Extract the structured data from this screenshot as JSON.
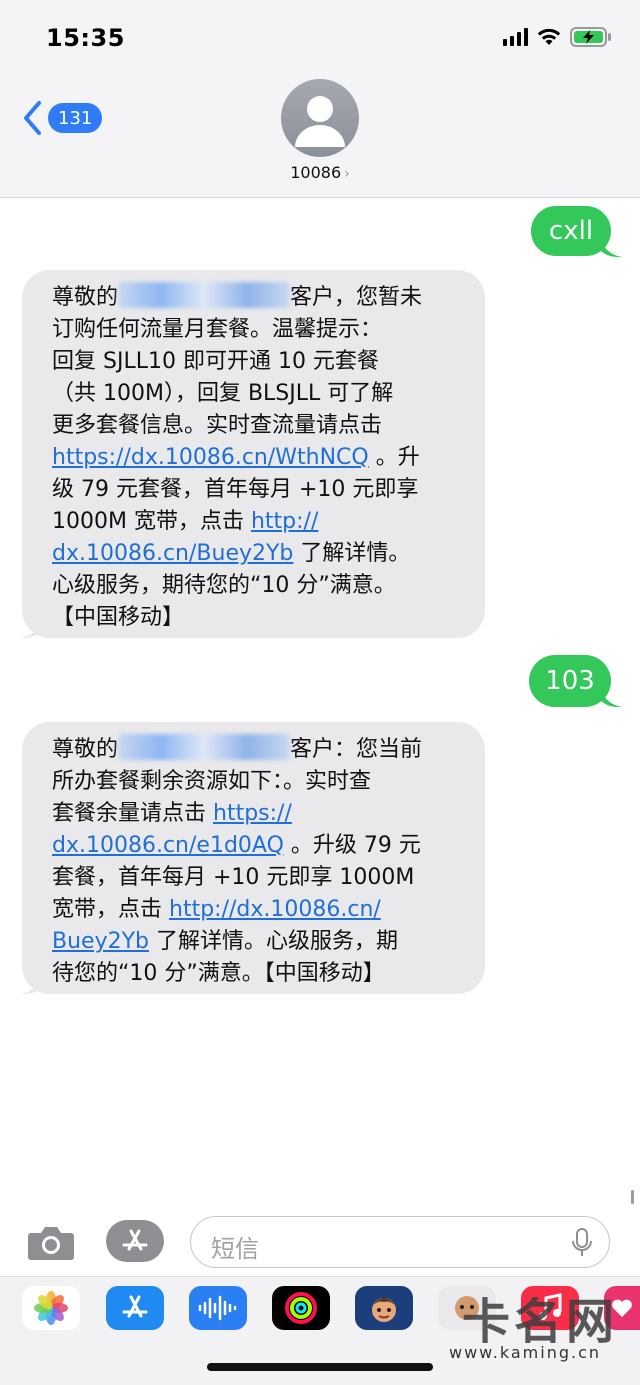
{
  "status_bar": {
    "time": "15:35"
  },
  "header": {
    "back_count": "131",
    "contact": "10086",
    "chevron": "›"
  },
  "messages": [
    {
      "type": "sent",
      "text": "cxll"
    },
    {
      "type": "received",
      "lines": [
        [
          "尊敬的",
          "[blurred]",
          "客户，您暂未"
        ],
        [
          "订购任何流量月套餐。温馨提示："
        ],
        [
          "回复 SJLL10 即可开通 10 元套餐"
        ],
        [
          "（共 100M），回复 BLSJLL 可了解"
        ],
        [
          "更多套餐信息。实时查流量请点击"
        ],
        [
          "https://dx.10086.cn/WthNCQ",
          " 。升"
        ],
        [
          "级 79 元套餐，首年每月 +10 元即享"
        ],
        [
          "1000M 宽带，点击 ",
          "http://"
        ],
        [
          "dx.10086.cn/Buey2Yb",
          " 了解详情。"
        ],
        [
          "心级服务，期待您的“10 分”满意。"
        ],
        [
          "【中国移动】"
        ]
      ]
    },
    {
      "type": "sent",
      "text": "103"
    },
    {
      "type": "received",
      "lines": [
        [
          "尊敬的",
          "[blurred]",
          "客户：您当前"
        ],
        [
          "所办套餐剩余资源如下：。实时查"
        ],
        [
          "套餐余量请点击 ",
          "https://"
        ],
        [
          "dx.10086.cn/e1d0AQ",
          " 。升级 79 元"
        ],
        [
          "套餐，首年每月 +10 元即享 1000M"
        ],
        [
          "宽带，点击 ",
          "http://dx.10086.cn/"
        ],
        [
          "Buey2Yb",
          " 了解详情。心级服务，期"
        ],
        [
          "待您的“10 分”满意。【中国移动】"
        ]
      ]
    }
  ],
  "m1": {
    "l1a": "尊敬的",
    "l1b": "客户，您暂未",
    "l2": "订购任何流量月套餐。温馨提示：",
    "l3": "回复 SJLL10 即可开通 10 元套餐",
    "l4": "（共 100M），回复 BLSJLL 可了解",
    "l5": "更多套餐信息。实时查流量请点击",
    "l6link": "https://dx.10086.cn/WthNCQ",
    "l6b": " 。升",
    "l7": "级 79 元套餐，首年每月 +10 元即享",
    "l8a": "1000M 宽带，点击 ",
    "l8link": "http://",
    "l9link": "dx.10086.cn/Buey2Yb",
    "l9b": " 了解详情。",
    "l10": "心级服务，期待您的“10 分”满意。",
    "l11": "【中国移动】"
  },
  "m2": {
    "l1a": "尊敬的",
    "l1b": "客户：您当前",
    "l2": "所办套餐剩余资源如下：。实时查",
    "l3a": "套餐余量请点击 ",
    "l3link": "https://",
    "l4link": "dx.10086.cn/e1d0AQ",
    "l4b": " 。升级 79 元",
    "l5": "套餐，首年每月 +10 元即享 1000M",
    "l6a": "宽带，点击 ",
    "l6link": "http://dx.10086.cn/",
    "l7link": "Buey2Yb",
    "l7b": " 了解详情。心级服务，期",
    "l8": "待您的“10 分”满意。【中国移动】"
  },
  "sent": {
    "s1": "cxll",
    "s2": "103"
  },
  "input": {
    "placeholder": "短信"
  },
  "drawer_apps": [
    "photos-icon",
    "app-store-icon",
    "audio-icon",
    "activity-icon",
    "memoji-icon",
    "memoji-stickers-icon",
    "music-icon",
    "heart-icon"
  ],
  "watermark": {
    "big": "卡名网",
    "small": "www.kaming.cn"
  },
  "colors": {
    "sent_bubble": "#34c759",
    "received_bubble": "#e9e9eb",
    "link": "#1f6fd6",
    "badge": "#2f7cf6"
  }
}
